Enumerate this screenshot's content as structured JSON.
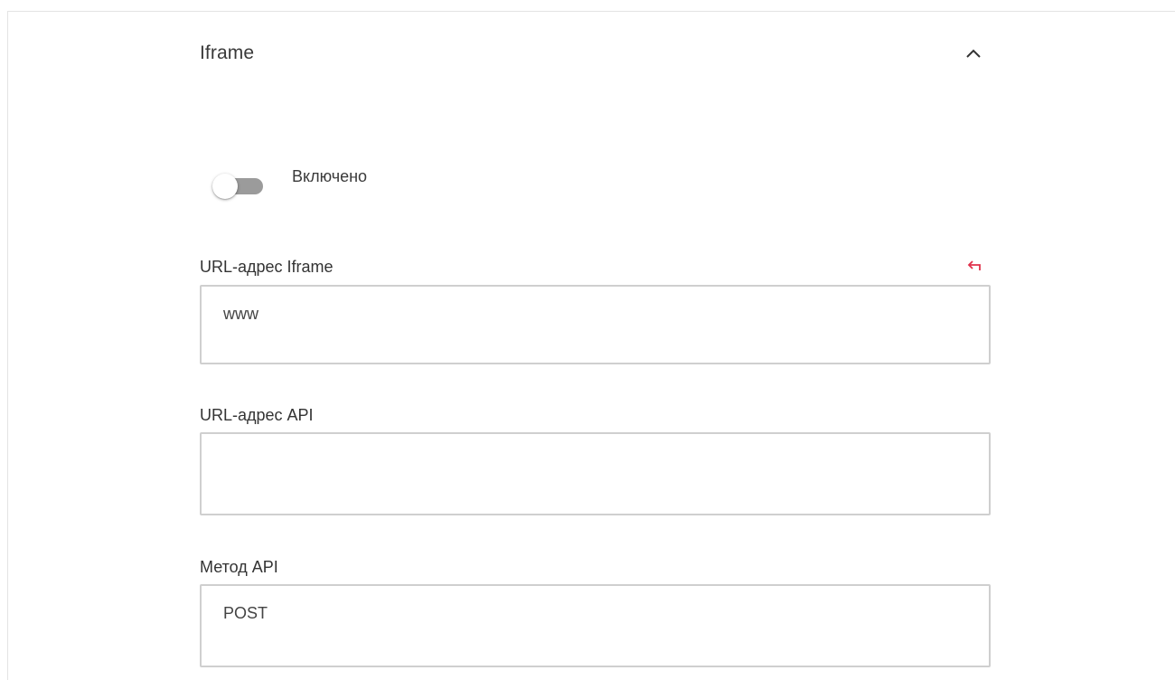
{
  "section": {
    "title": "Iframe",
    "collapse_icon": "chevron-up-icon"
  },
  "toggle": {
    "label": "Включено",
    "checked": false
  },
  "fields": [
    {
      "label": "URL-адрес Iframe",
      "value": "www",
      "reset_icon": "undo-arrow-icon",
      "reset_color": "#e0314b"
    },
    {
      "label": "URL-адрес API",
      "value": ""
    },
    {
      "label": "Метод API",
      "value": "POST"
    }
  ],
  "colors": {
    "toggle_track": "#9b9b9b",
    "input_border": "#cfcfcf",
    "accent_reset": "#e0314b"
  }
}
